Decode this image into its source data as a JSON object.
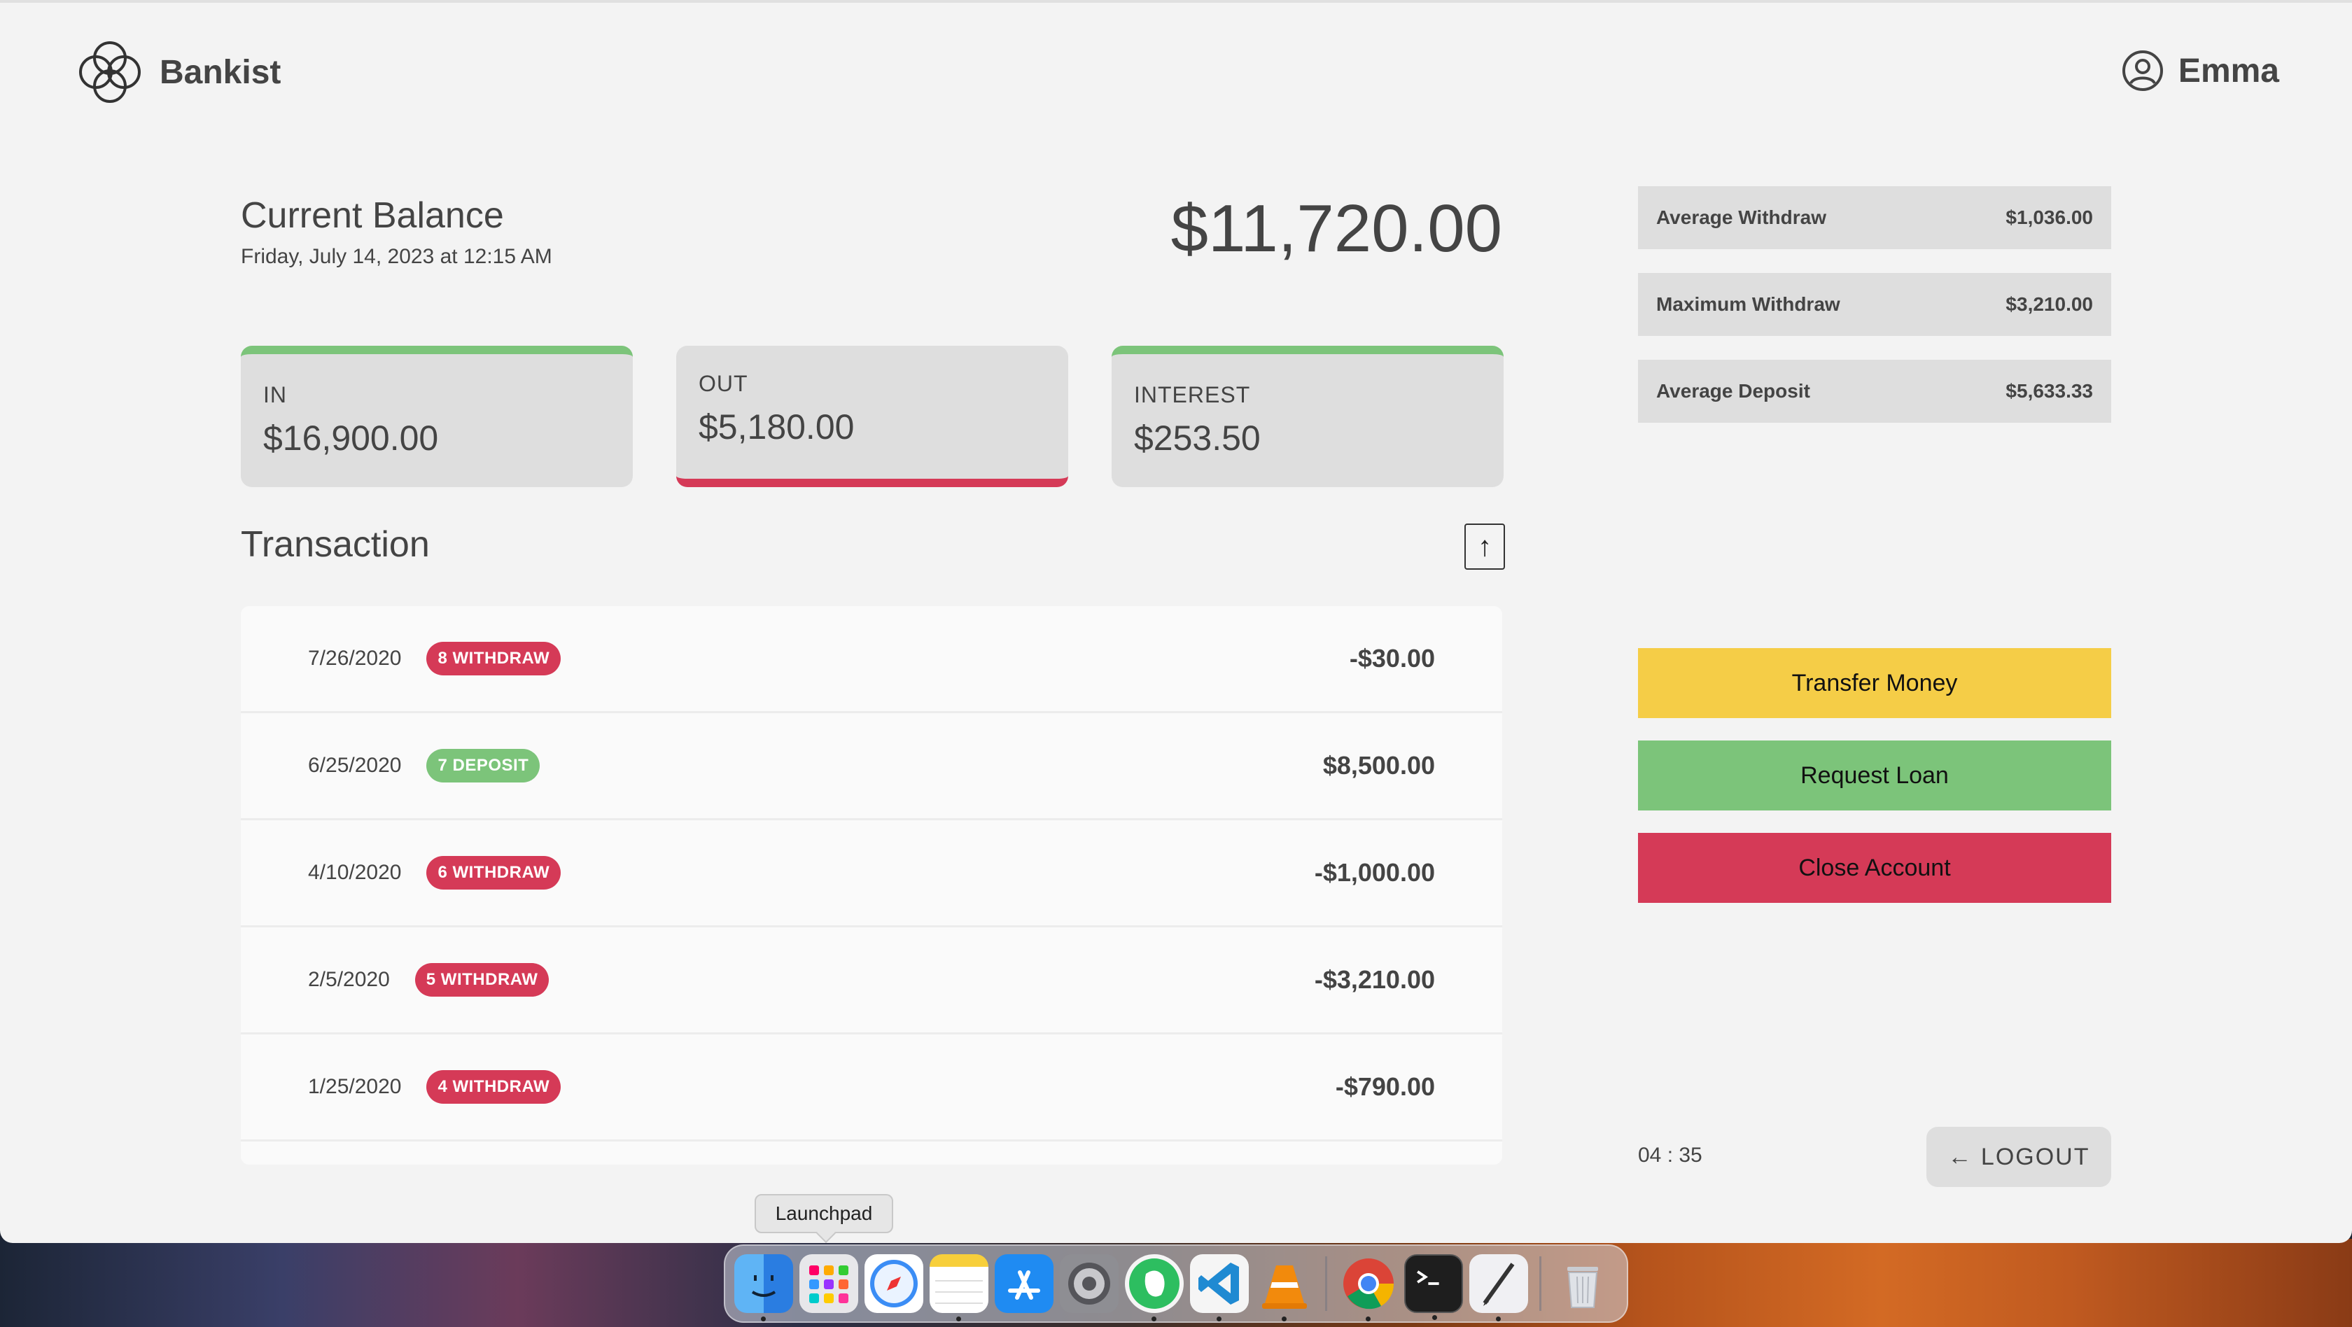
{
  "header": {
    "brand_name": "Bankist",
    "user_name": "Emma"
  },
  "balance": {
    "label": "Current Balance",
    "date": "Friday, July 14, 2023 at 12:15 AM",
    "value": "$11,720.00"
  },
  "summary": {
    "in": {
      "label": "IN",
      "value": "$16,900.00"
    },
    "out": {
      "label": "OUT",
      "value": "$5,180.00"
    },
    "interest": {
      "label": "INTEREST",
      "value": "$253.50"
    }
  },
  "transactions": {
    "title": "Transaction",
    "sort_symbol": "↑",
    "rows": [
      {
        "date": "7/26/2020",
        "type": "8 WITHDRAW",
        "amount": "-$30.00"
      },
      {
        "date": "6/25/2020",
        "type": "7 DEPOSIT",
        "amount": "$8,500.00"
      },
      {
        "date": "4/10/2020",
        "type": "6 WITHDRAW",
        "amount": "-$1,000.00"
      },
      {
        "date": "2/5/2020",
        "type": "5 WITHDRAW",
        "amount": "-$3,210.00"
      },
      {
        "date": "1/25/2020",
        "type": "4 WITHDRAW",
        "amount": "-$790.00"
      }
    ]
  },
  "stats": [
    {
      "label": "Average Withdraw",
      "value": "$1,036.00"
    },
    {
      "label": "Maximum Withdraw",
      "value": "$3,210.00"
    },
    {
      "label": "Average Deposit",
      "value": "$5,633.33"
    }
  ],
  "actions": {
    "transfer": "Transfer Money",
    "loan": "Request Loan",
    "close": "Close Account"
  },
  "timer": "04 : 35",
  "logout": "← LOGOUT",
  "dock": {
    "tooltip": "Launchpad",
    "apps": [
      "finder-icon",
      "launchpad-icon",
      "safari-icon",
      "notes-icon",
      "app-store-icon",
      "system-settings-icon",
      "evernote-icon",
      "vscode-icon",
      "vlc-icon",
      "chrome-icon",
      "terminal-icon",
      "script-editor-icon",
      "trash-icon"
    ]
  },
  "colors": {
    "accent_green": "#7cc47a",
    "accent_red": "#d53a57",
    "accent_yellow": "#f5cd47",
    "background": "#f3f3f3"
  }
}
